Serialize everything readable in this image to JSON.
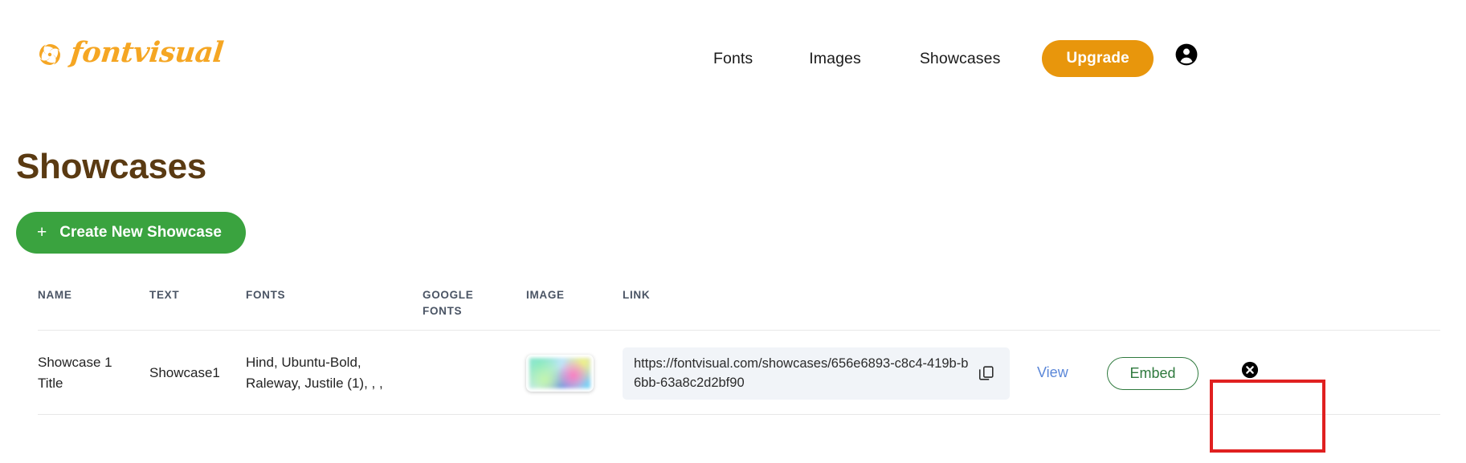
{
  "brand": {
    "name": "fontvisual",
    "logo_color": "#f5a623"
  },
  "header": {
    "nav": [
      {
        "label": "Fonts"
      },
      {
        "label": "Images"
      },
      {
        "label": "Showcases"
      }
    ],
    "upgrade_label": "Upgrade",
    "upgrade_color": "#e8960c",
    "account_icon": "account-circle-icon"
  },
  "main": {
    "page_title": "Showcases",
    "title_color": "#5a3a12",
    "create_button": {
      "plus": "+",
      "label": "Create New Showcase",
      "color": "#3aa33f"
    }
  },
  "table": {
    "headers": {
      "name": "NAME",
      "text": "TEXT",
      "fonts": "FONTS",
      "google_fonts_line1": "GOOGLE",
      "google_fonts_line2": "FONTS",
      "image": "IMAGE",
      "link": "LINK"
    },
    "rows": [
      {
        "name": "Showcase 1 Title",
        "text": "Showcase1",
        "fonts": "Hind, Ubuntu-Bold, Raleway, Justile (1), , ,",
        "google_fonts": "",
        "image_alt": "showcase-thumbnail",
        "link_url": "https://fontvisual.com/showcases/656e6893-c8c4-419b-b6bb-63a8c2d2bf90",
        "copy_icon": "copy-icon",
        "view_label": "View",
        "view_color": "#5b87d8",
        "embed_label": "Embed",
        "embed_color": "#2f7a3e",
        "delete_icon": "close-circle-icon"
      }
    ]
  },
  "annotation": {
    "type": "highlight-rectangle",
    "color": "#e02020",
    "target": "embed-button"
  }
}
